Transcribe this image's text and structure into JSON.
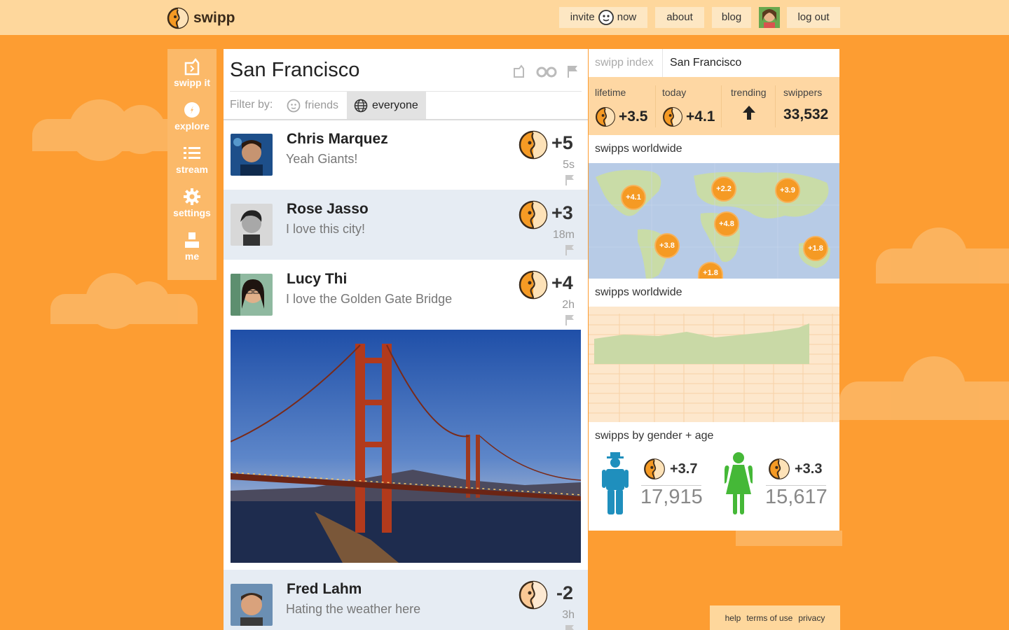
{
  "header": {
    "logo_text": "swipp",
    "nav": {
      "invite_before": "invite",
      "invite_after": "now",
      "about": "about",
      "blog": "blog",
      "logout": "log out"
    }
  },
  "sidenav": {
    "items": [
      {
        "label": "swipp it",
        "icon": "swipp-it-icon"
      },
      {
        "label": "explore",
        "icon": "compass-icon"
      },
      {
        "label": "stream",
        "icon": "list-icon"
      },
      {
        "label": "settings",
        "icon": "gear-icon"
      },
      {
        "label": "me",
        "icon": "person-icon"
      }
    ]
  },
  "feed": {
    "title": "San Francisco",
    "filter_label": "Filter by:",
    "filters": [
      {
        "label": "friends",
        "selected": false
      },
      {
        "label": "everyone",
        "selected": true
      }
    ],
    "posts": [
      {
        "name": "Chris Marquez",
        "message": "Yeah Giants!",
        "score": "+5",
        "time": "5s"
      },
      {
        "name": "Rose Jasso",
        "message": "I love this city!",
        "score": "+3",
        "time": "18m"
      },
      {
        "name": "Lucy Thi",
        "message": "I love the Golden Gate Bridge",
        "score": "+4",
        "time": "2h"
      },
      {
        "name": "Fred Lahm",
        "message": "Hating the weather here",
        "score": "-2",
        "time": "3h"
      }
    ]
  },
  "stats": {
    "tabs": [
      "swipp index",
      "San Francisco"
    ],
    "kpis": {
      "lifetime_label": "lifetime",
      "lifetime_value": "+3.5",
      "today_label": "today",
      "today_value": "+4.1",
      "trending_label": "trending",
      "swippers_label": "swippers",
      "swippers_value": "33,532"
    },
    "map_title": "swipps worldwide",
    "map_bubbles": [
      "+4.1",
      "+2.2",
      "+3.9",
      "+4.8",
      "+3.8",
      "+1.8",
      "+1.8"
    ],
    "chart_title": "swipps worldwide",
    "gender_title": "swipps by gender + age",
    "male": {
      "score": "+3.7",
      "count": "17,915"
    },
    "female": {
      "score": "+3.3",
      "count": "15,617"
    }
  },
  "footer": {
    "help": "help",
    "terms": "terms of use",
    "privacy": "privacy"
  },
  "colors": {
    "background": "#fd9d32",
    "header": "#fed79c",
    "accent": "#f59a24",
    "male": "#1f8fbd",
    "female": "#45b837"
  }
}
